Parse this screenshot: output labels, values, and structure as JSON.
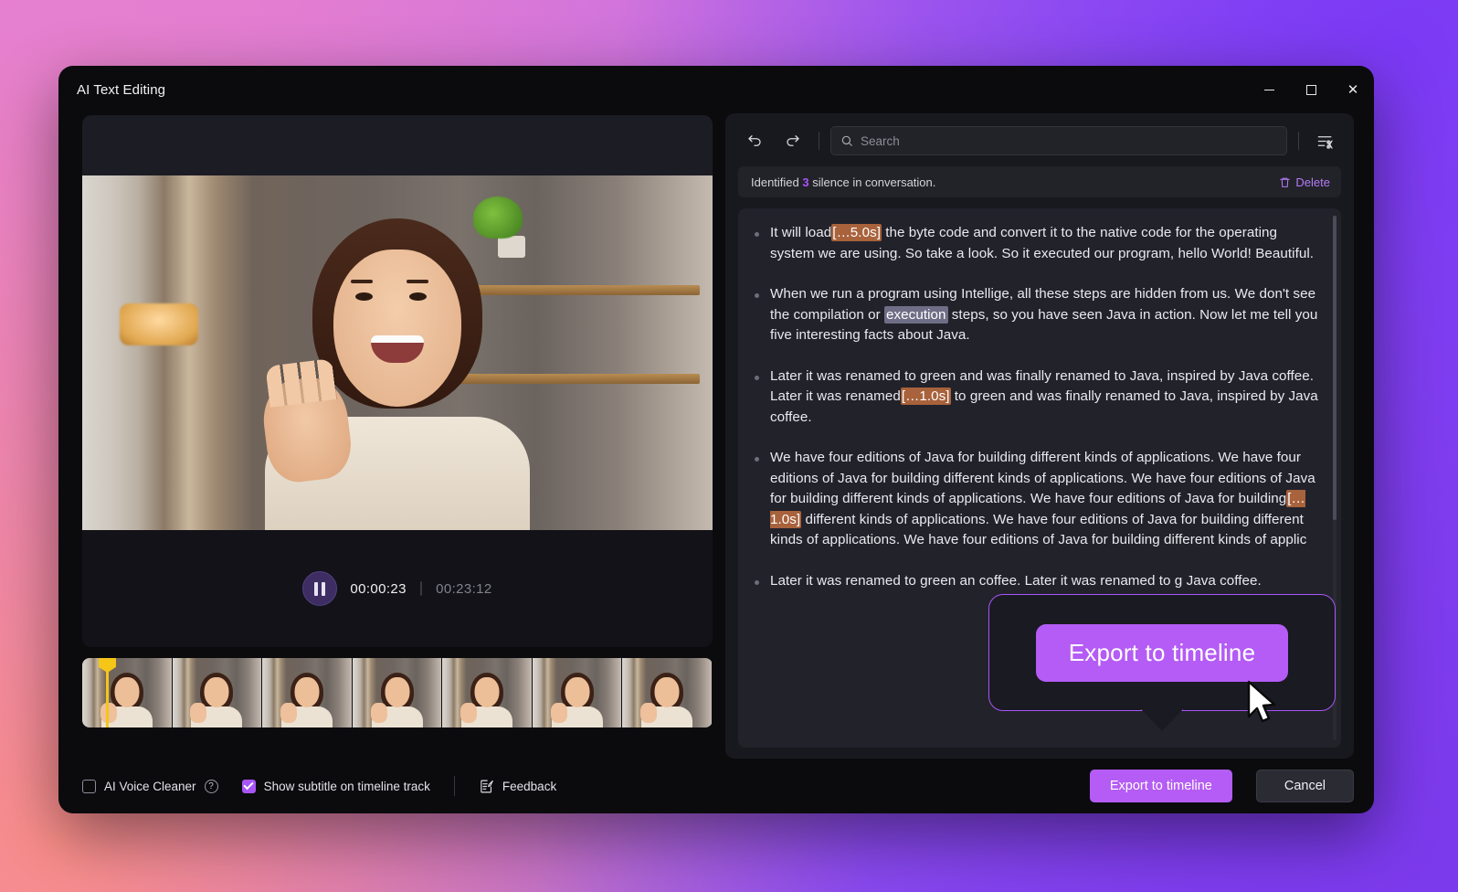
{
  "window": {
    "title": "AI Text Editing",
    "controls": {
      "minimize": "–",
      "maximize": "▭",
      "close": "✕"
    }
  },
  "player": {
    "play_state_icon": "pause-icon",
    "current_time": "00:00:23",
    "separator": "|",
    "total_time": "00:23:12",
    "filmstrip_frames": 7,
    "playhead_color": "#f5c518"
  },
  "transcript": {
    "toolbar": {
      "undo_icon": "undo-icon",
      "redo_icon": "redo-icon",
      "trim_icon": "trim-text-icon"
    },
    "search": {
      "value": "",
      "placeholder": "Search",
      "icon": "search-icon"
    },
    "banner": {
      "prefix": "Identified",
      "count": "3",
      "suffix": "silence in conversation.",
      "delete_label": "Delete",
      "delete_icon": "trash-icon",
      "accent": "#a855f7"
    },
    "paragraphs": [
      {
        "segments": [
          {
            "type": "text",
            "value": "It will load"
          },
          {
            "type": "silence",
            "value": "[…5.0s]"
          },
          {
            "type": "text",
            "value": " the byte code and convert it to the native code for the operating system we are using. So take a look. So it executed our program, hello World! Beautiful."
          }
        ]
      },
      {
        "segments": [
          {
            "type": "text",
            "value": "When we run a program using Intellige, all these steps are hidden from us. We don't see the compilation or "
          },
          {
            "type": "selected",
            "value": "execution"
          },
          {
            "type": "text",
            "value": " steps, so you have seen Java in action. Now let me tell you five interesting facts about Java."
          }
        ]
      },
      {
        "segments": [
          {
            "type": "text",
            "value": "Later it was renamed to green and was finally renamed to Java, inspired by Java coffee. Later it was renamed"
          },
          {
            "type": "silence",
            "value": "[…1.0s]"
          },
          {
            "type": "text",
            "value": " to green and was finally renamed to Java, inspired by Java coffee."
          }
        ]
      },
      {
        "segments": [
          {
            "type": "text",
            "value": "We have four editions of Java for building different kinds of applications. We have four editions of Java for building different kinds of applications. We have four editions of Java for building different kinds of applications. We have four editions of Java for building"
          },
          {
            "type": "silence",
            "value": "[…1.0s]"
          },
          {
            "type": "text",
            "value": " different kinds of applications. We have four editions of Java for building different kinds of applications. We have four editions of Java for building different kinds of applic"
          }
        ]
      },
      {
        "segments": [
          {
            "type": "text",
            "value": "Later it was renamed to green an coffee. Later it was renamed to g Java coffee."
          }
        ]
      }
    ],
    "silence_highlight_color": "#a8623c",
    "selection_highlight_color": "#6e6e86"
  },
  "callout": {
    "export_label": "Export to timeline",
    "border_color": "#a855f7",
    "button_color": "#b45cf5",
    "cursor_icon": "mouse-pointer-icon"
  },
  "footer": {
    "voice_cleaner": {
      "label": "AI Voice Cleaner",
      "checked": false,
      "help_icon": "help-circle-icon",
      "help_glyph": "?"
    },
    "subtitle_toggle": {
      "label": "Show subtitle on timeline track",
      "checked": true
    },
    "feedback": {
      "label": "Feedback",
      "icon": "feedback-icon"
    },
    "export_label": "Export to timeline",
    "cancel_label": "Cancel"
  }
}
